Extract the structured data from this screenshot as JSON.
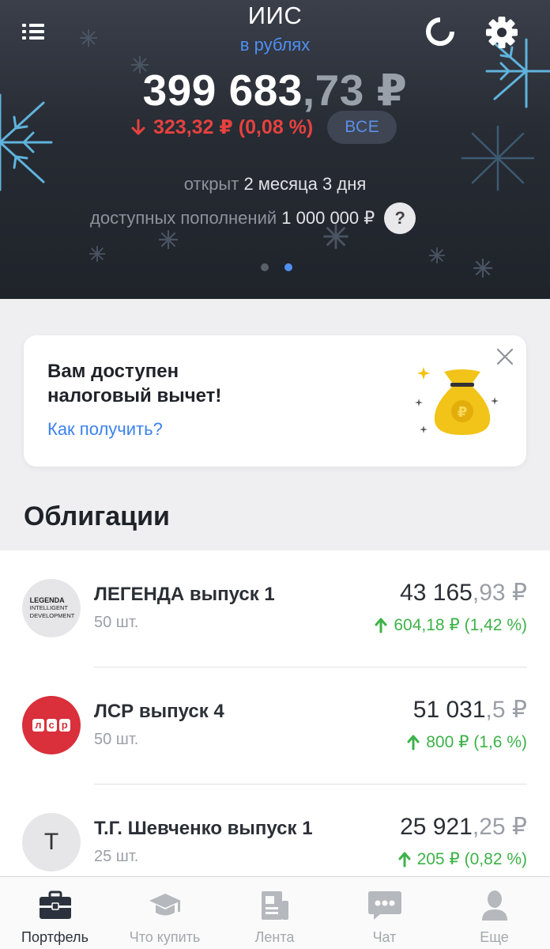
{
  "header": {
    "title": "ИИС",
    "subtitle": "в рублях",
    "total_int": "399 683",
    "total_frac": ",73 ₽",
    "change_text": "323,32 ₽ (0,08 %)",
    "all_label": "ВСЕ",
    "opened_label": "открыт",
    "opened_value": "2 месяца 3 дня",
    "deposits_label": "доступных пополнений",
    "deposits_value": "1 000 000 ₽",
    "help_label": "?",
    "pager": {
      "count": 2,
      "active": 2
    },
    "colors": {
      "accent": "#4f8ff3",
      "loss": "#e5423f"
    }
  },
  "promo": {
    "title": "Вам доступен налоговый вычет!",
    "link": "Как получить?",
    "icon": "money-bag-icon"
  },
  "section": {
    "title": "Облигации"
  },
  "bonds": [
    {
      "name": "ЛЕГЕНДА выпуск 1",
      "qty": "50 шт.",
      "price_int": "43 165",
      "price_frac": ",93 ₽",
      "gain": "604,18 ₽ (1,42 %)",
      "logo": {
        "type": "legenda",
        "line1": "LEGENDA",
        "line2": "INTELLIGENT",
        "line3": "DEVELOPMENT"
      }
    },
    {
      "name": "ЛСР выпуск 4",
      "qty": "50 шт.",
      "price_int": "51 031",
      "price_frac": ",5 ₽",
      "gain": "800 ₽ (1,6 %)",
      "logo": {
        "type": "lsr",
        "text": "лср"
      }
    },
    {
      "name": "Т.Г. Шевченко выпуск 1",
      "qty": "25 шт.",
      "price_int": "25 921",
      "price_frac": ",25 ₽",
      "gain": "205 ₽ (0,82 %)",
      "logo": {
        "type": "letter",
        "text": "Т"
      }
    }
  ],
  "tabs": [
    {
      "label": "Портфель",
      "icon": "briefcase-icon",
      "active": true
    },
    {
      "label": "Что купить",
      "icon": "graduation-cap-icon",
      "active": false
    },
    {
      "label": "Лента",
      "icon": "newspaper-icon",
      "active": false
    },
    {
      "label": "Чат",
      "icon": "chat-bubble-icon",
      "active": false
    },
    {
      "label": "Еще",
      "icon": "profile-icon",
      "active": false
    }
  ],
  "colors": {
    "gain": "#3db249",
    "link": "#3b82ee",
    "lsr_red": "#d9303b"
  }
}
